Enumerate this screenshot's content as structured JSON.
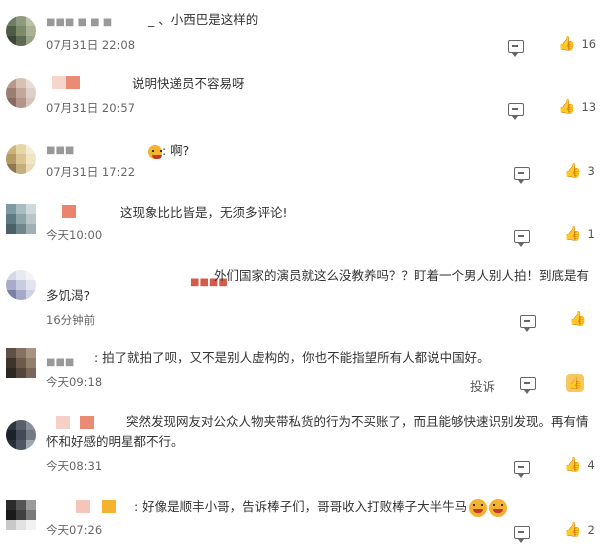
{
  "comments": [
    {
      "text": "_ 、小西巴是这样的",
      "time": "07月31日 22:08",
      "likes": "16"
    },
    {
      "text": "说明快递员不容易呀",
      "time": "07月31日 20:57",
      "likes": "13"
    },
    {
      "text": ": 啊?",
      "time": "07月31日 17:22",
      "likes": "3"
    },
    {
      "text": "这现象比比皆是，无须多评论!",
      "time": "今天10:00",
      "likes": "1"
    },
    {
      "text": "外们国家的演员就这么没教养吗？？盯着一个男人别人拍！到底是有多饥渴?",
      "time": "16分钟前",
      "likes": ""
    },
    {
      "text": ": 拍了就拍了呗，又不是别人虚构的，你也不能指望所有人都说中国好。",
      "time": "今天09:18",
      "likes": "",
      "report": "投诉"
    },
    {
      "text": "突然发现网友对公众人物夹带私货的行为不买账了，而且能够快速识别发现。再有情怀和好感的明星都不行。",
      "time": "今天08:31",
      "likes": "4"
    },
    {
      "text": ": 好像是顺丰小哥，告诉棒子们，哥哥收入打败棒子大半牛马",
      "time": "今天07:26",
      "likes": "2"
    }
  ],
  "colors": {
    "accent": "#f6c85f",
    "text": "#333333",
    "meta": "#666666"
  }
}
